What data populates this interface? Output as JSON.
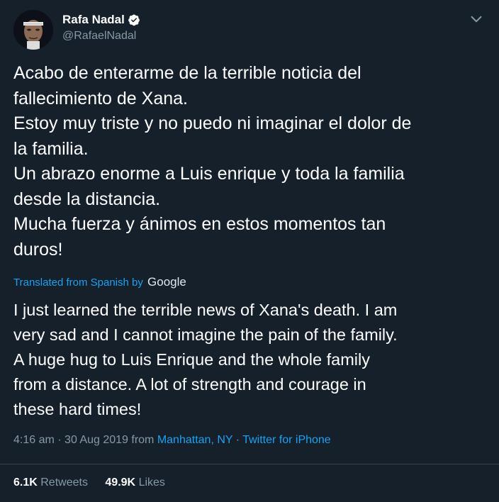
{
  "user": {
    "display_name": "Rafa Nadal",
    "handle": "@RafaelNadal",
    "verified": true,
    "avatar_icon": "profile-photo"
  },
  "tweet": {
    "text_lines": [
      "Acabo de enterarme de la terrible noticia del",
      "fallecimiento de Xana.",
      "Estoy muy triste y no puedo ni imaginar el dolor de",
      "la familia.",
      "Un abrazo enorme a Luis enrique y toda la familia",
      "desde la distancia.",
      "Mucha fuerza y ánimos en estos momentos tan",
      "duros!"
    ]
  },
  "translation": {
    "label": "Translated from Spanish by",
    "provider": "Google",
    "lines": [
      "I just learned the terrible news of Xana's death. I am",
      "very sad and I cannot imagine the pain of the family.",
      "A huge hug to Luis Enrique and the whole family",
      "from a distance. A lot of strength and courage in",
      "these hard times!"
    ]
  },
  "meta": {
    "time": "4:16 am",
    "separator": "·",
    "date": "30 Aug 2019",
    "from_label": "from",
    "location": "Manhattan, NY",
    "source": "Twitter for iPhone"
  },
  "stats": {
    "retweets_count": "6.1K",
    "retweets_label": "Retweets",
    "likes_count": "49.9K",
    "likes_label": "Likes"
  },
  "colors": {
    "background": "#15202b",
    "accent": "#1da1f2",
    "muted": "#8899a6"
  }
}
